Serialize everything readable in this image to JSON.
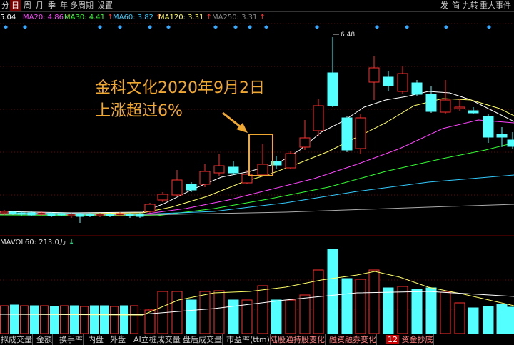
{
  "topbar": {
    "tabs": [
      "分",
      "日",
      "周",
      "月",
      "季",
      "年",
      "多周期",
      "设置"
    ],
    "active_tab": "日",
    "right_tabs": [
      "发",
      "简",
      "九转",
      "重大事件"
    ]
  },
  "ma_legend": [
    {
      "label": "5.04",
      "color": "#ffffff"
    },
    {
      "label": "MA20: 4.86",
      "color": "#ff44ff",
      "arrow": "↑"
    },
    {
      "label": "MA30: 4.41",
      "color": "#33ff33",
      "arrow": "↑"
    },
    {
      "label": "MA60: 3.82",
      "color": "#33ccff",
      "arrow": "↑"
    },
    {
      "label": "MA120: 3.31",
      "color": "#ffff66",
      "arrow": "↑"
    },
    {
      "label": "MA250: 3.31",
      "color": "#888888",
      "arrow": "↑"
    }
  ],
  "annotation": {
    "line1": "金科文化2020年9月2日",
    "line2": "上涨超过6%"
  },
  "peak_label": "6.48",
  "volume_legend": {
    "label": "MAVOL60: 213.0万",
    "arrow": "↓"
  },
  "colors": {
    "up": "#ff3030",
    "down": "#54ffff",
    "highlight": "#f0a830",
    "marker": "#33aaff"
  },
  "bottom_tabs": [
    "拟成交量",
    "金额",
    "换手率",
    "内盘",
    "外盘",
    "AI立桩成交量",
    "盘后成交量",
    "市盈率(ttm)",
    "陆股通持股变化",
    "融资融券变化",
    "资金抄底"
  ],
  "bottom_badge": "12"
}
